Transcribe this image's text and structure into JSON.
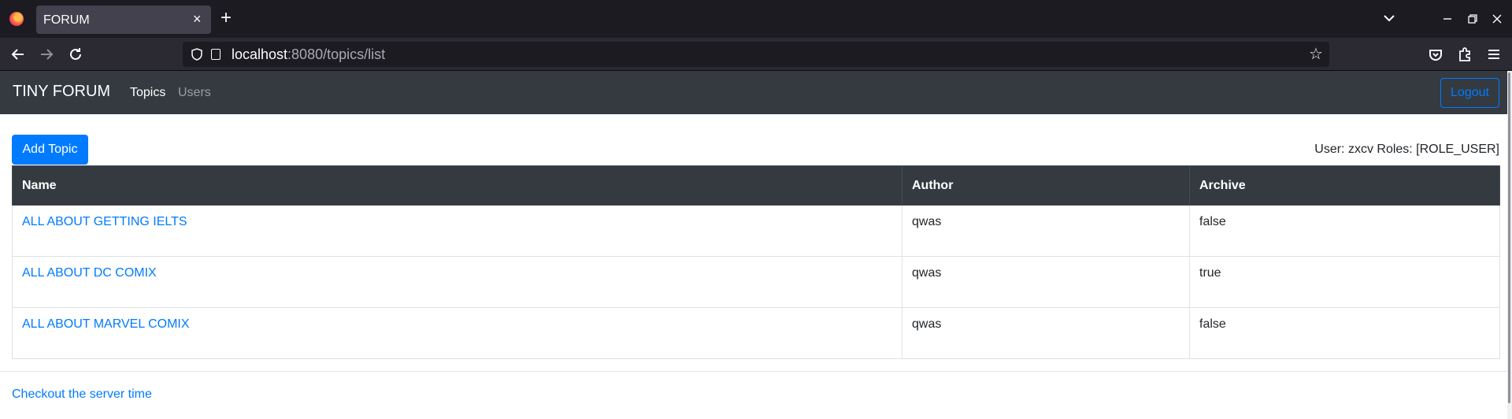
{
  "browser": {
    "tab_title": "FORUM",
    "tab_close": "×",
    "new_tab": "+",
    "url_host": "localhost",
    "url_rest": ":8080/topics/list"
  },
  "app": {
    "brand": "TINY FORUM",
    "nav": {
      "topics": "Topics",
      "users": "Users"
    },
    "logout": "Logout"
  },
  "content": {
    "add_topic": "Add Topic",
    "user_info": "User: zxcv Roles: [ROLE_USER]",
    "table": {
      "headers": {
        "name": "Name",
        "author": "Author",
        "archive": "Archive"
      },
      "rows": [
        {
          "name": "ALL ABOUT GETTING IELTS",
          "author": "qwas",
          "archive": "false"
        },
        {
          "name": "ALL ABOUT DC COMIX",
          "author": "qwas",
          "archive": "true"
        },
        {
          "name": "ALL ABOUT MARVEL COMIX",
          "author": "qwas",
          "archive": "false"
        }
      ]
    },
    "footer_link": "Checkout the server time"
  },
  "colors": {
    "primary": "#007bff",
    "navbar": "#343a40",
    "chrome_dark": "#1c1b22"
  }
}
